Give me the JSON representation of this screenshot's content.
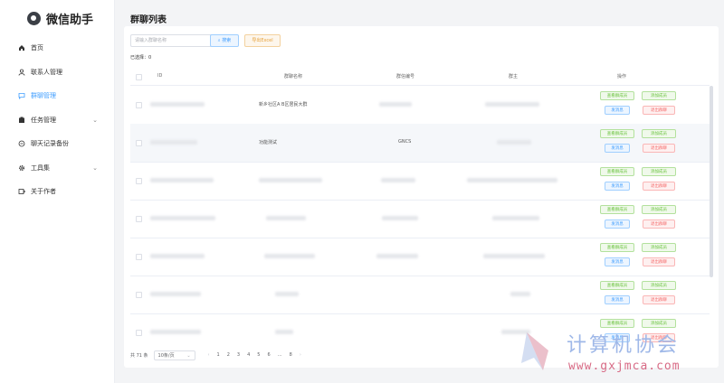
{
  "app": {
    "title": "微信助手"
  },
  "sidebar": {
    "items": [
      {
        "label": "首页",
        "icon": "home-icon",
        "active": false
      },
      {
        "label": "联系人管理",
        "icon": "user-icon",
        "active": false
      },
      {
        "label": "群聊管理",
        "icon": "chat-icon",
        "active": true
      },
      {
        "label": "任务管理",
        "icon": "task-icon",
        "active": false,
        "expandable": true
      },
      {
        "label": "聊天记录备份",
        "icon": "backup-icon",
        "active": false
      },
      {
        "label": "工具集",
        "icon": "gear-icon",
        "active": false,
        "expandable": true
      },
      {
        "label": "关于作者",
        "icon": "author-icon",
        "active": false
      }
    ]
  },
  "page": {
    "title": "群聊列表"
  },
  "toolbar": {
    "search_placeholder": "请输入群聊名称",
    "search_label": "搜索",
    "export_label": "导出Excel",
    "selected_label": "已选择：0"
  },
  "table": {
    "headers": [
      "ID",
      "群聊名称",
      "群信编号",
      "群主",
      "操作"
    ],
    "rows": [
      {
        "name": "新乡社区A B区居民大群",
        "code": "",
        "alt": false
      },
      {
        "name": "功能测试",
        "code": "GNCS",
        "alt": true
      },
      {
        "name": "",
        "code": "",
        "alt": false
      },
      {
        "name": "",
        "code": "",
        "alt": false
      },
      {
        "name": "",
        "code": "",
        "alt": false
      },
      {
        "name": "",
        "code": "",
        "alt": false
      },
      {
        "name": "",
        "code": "",
        "alt": false
      }
    ],
    "actions": {
      "view_members": "查看群成员",
      "add_member": "添加成员",
      "send_msg": "发消息",
      "quit_group": "退出群聊"
    }
  },
  "pagination": {
    "total": "共 71 条",
    "page_size": "10条/页",
    "prev": "‹",
    "next": "›",
    "pages": [
      "1",
      "2",
      "3",
      "4",
      "5",
      "6",
      "…",
      "8"
    ]
  },
  "watermark": {
    "text": "计算机协会",
    "url": "www.gxjmca.com"
  },
  "colors": {
    "primary": "#409eff",
    "success": "#67c23a",
    "warning": "#e6a23c",
    "danger": "#f56c6c"
  }
}
